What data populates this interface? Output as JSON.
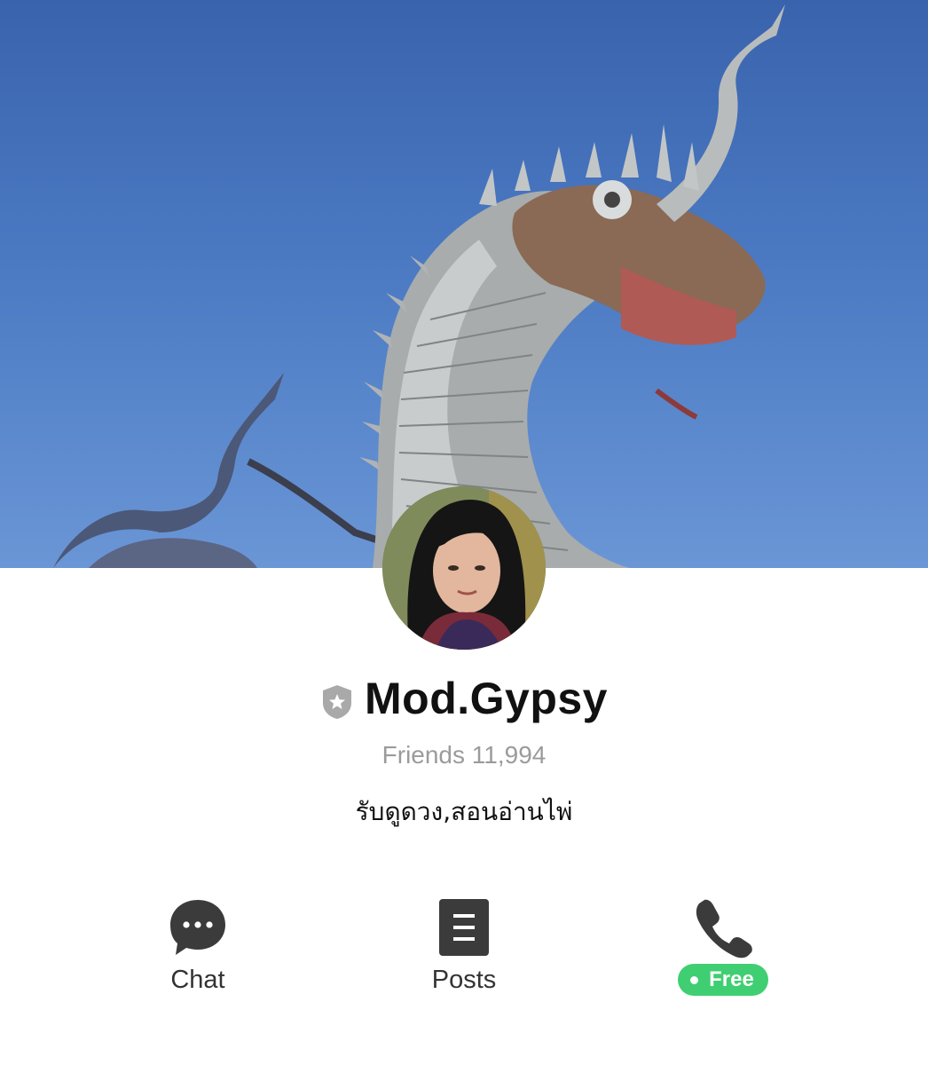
{
  "cover": {
    "image": "naga-serpent-statue-blue-sky"
  },
  "profile": {
    "avatar": "profile-photo",
    "badge_icon": "shield-star-icon",
    "name": "Mod.Gypsy",
    "friends_label": "Friends 11,994",
    "status_message": "รับดูดวง,สอนอ่านไพ่"
  },
  "actions": [
    {
      "label": "Chat",
      "icon": "chat-bubble-icon"
    },
    {
      "label": "Posts",
      "icon": "document-icon"
    },
    {
      "label": "Free",
      "icon": "phone-icon"
    }
  ],
  "colors": {
    "free_green": "#3fcf72",
    "icon_dark": "#3b3b3b",
    "sky_blue": "#4a79c2"
  }
}
